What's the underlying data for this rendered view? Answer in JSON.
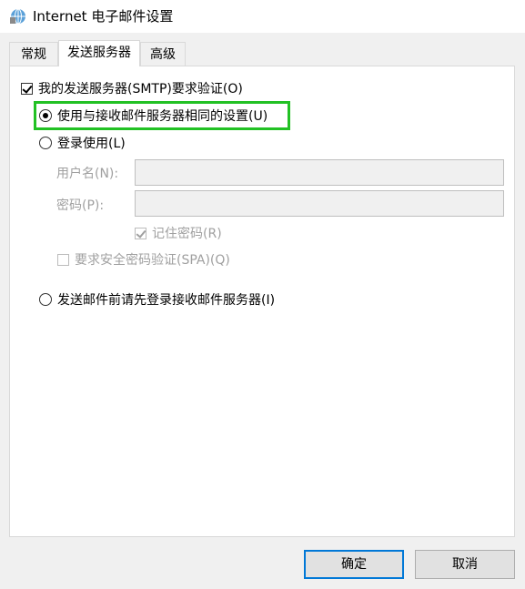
{
  "window": {
    "title": "Internet 电子邮件设置",
    "icon": "internet-globe-icon"
  },
  "tabs": [
    {
      "label": "常规",
      "active": false
    },
    {
      "label": "发送服务器",
      "active": true
    },
    {
      "label": "高级",
      "active": false
    }
  ],
  "outgoing": {
    "smtp_auth_label": "我的发送服务器(SMTP)要求验证(O)",
    "smtp_auth_checked": true,
    "same_settings_label": "使用与接收邮件服务器相同的设置(U)",
    "login_with_label": "登录使用(L)",
    "username_label": "用户名(N):",
    "username_value": "",
    "password_label": "密码(P):",
    "password_value": "",
    "remember_password_label": "记住密码(R)",
    "remember_password_checked": true,
    "spa_label": "要求安全密码验证(SPA)(Q)",
    "spa_checked": false,
    "login_before_send_label": "发送邮件前请先登录接收邮件服务器(I)",
    "selected_option": "same_settings"
  },
  "buttons": {
    "ok_label": "确定",
    "cancel_label": "取消"
  },
  "colors": {
    "highlight": "#22c124",
    "default_button_border": "#0078d7"
  }
}
